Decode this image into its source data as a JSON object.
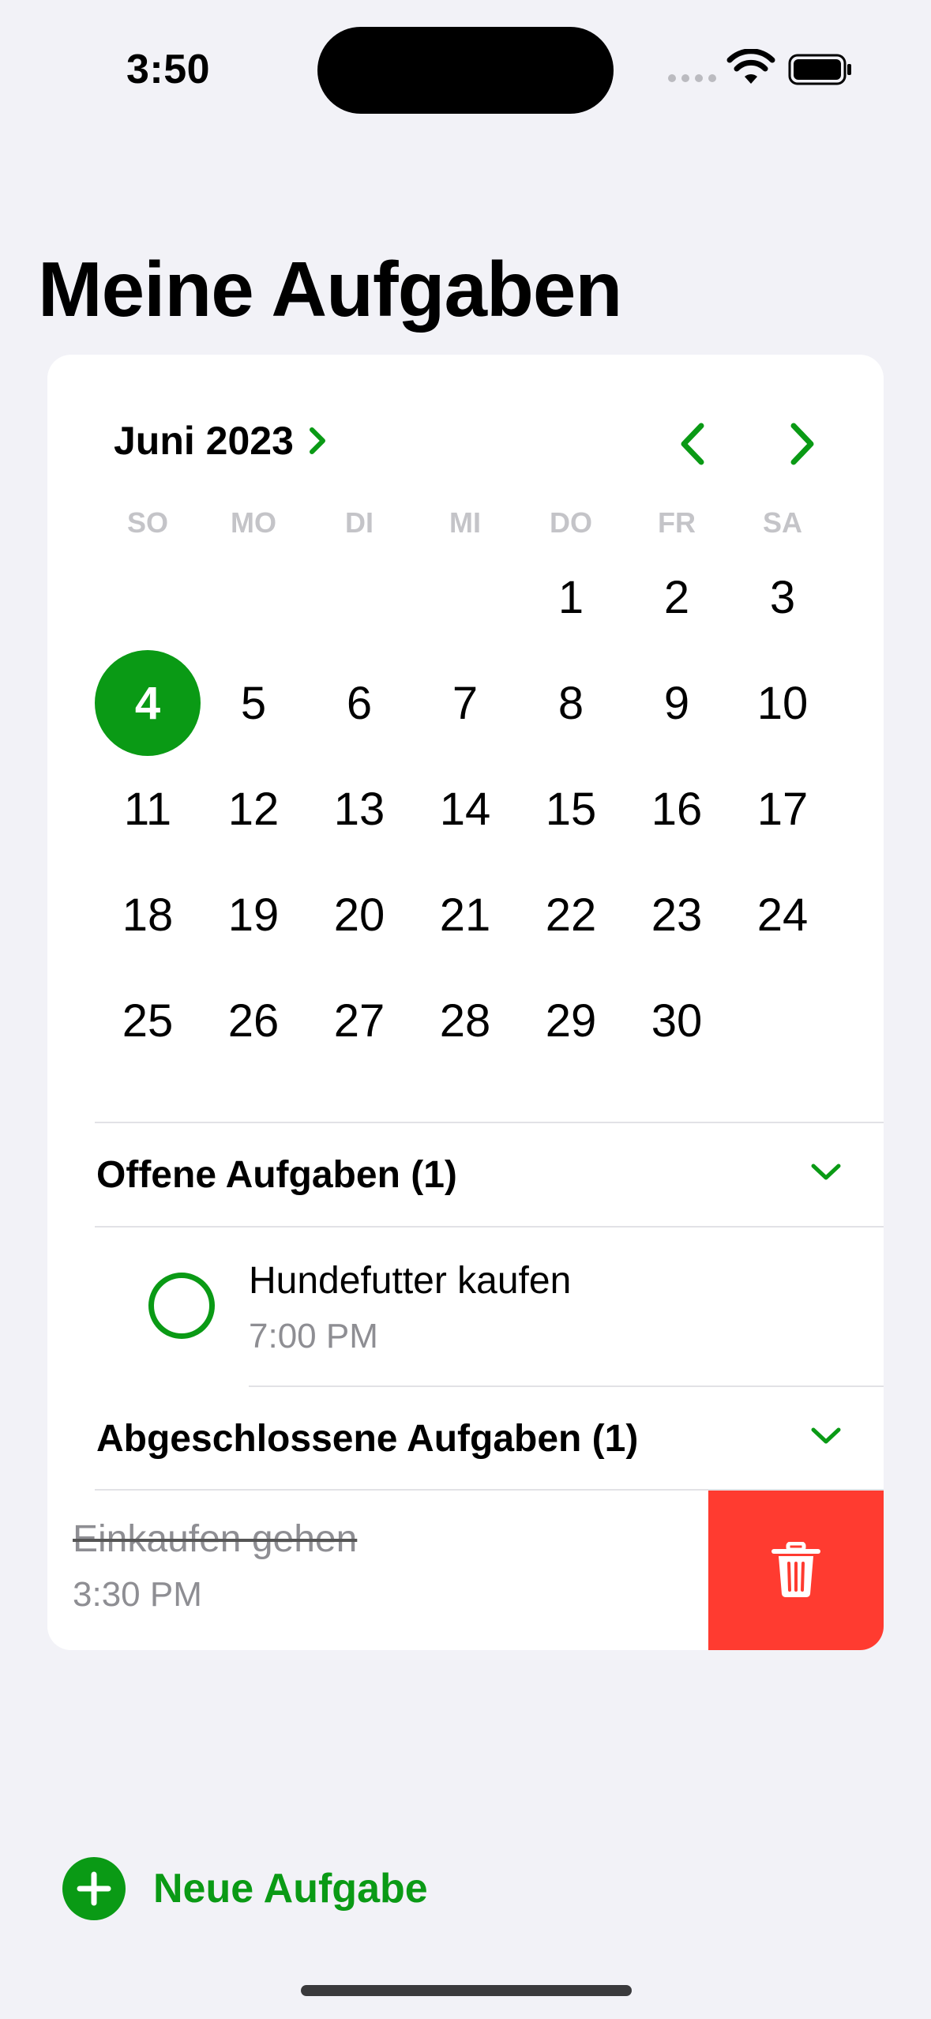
{
  "status_bar": {
    "time": "3:50"
  },
  "page_title": "Meine Aufgaben",
  "calendar": {
    "month_label": "Juni 2023",
    "weekdays": [
      "SO",
      "MO",
      "DI",
      "MI",
      "DO",
      "FR",
      "SA"
    ],
    "selected_day": "4",
    "weeks": [
      [
        "",
        "",
        "",
        "",
        "1",
        "2",
        "3"
      ],
      [
        "4",
        "5",
        "6",
        "7",
        "8",
        "9",
        "10"
      ],
      [
        "11",
        "12",
        "13",
        "14",
        "15",
        "16",
        "17"
      ],
      [
        "18",
        "19",
        "20",
        "21",
        "22",
        "23",
        "24"
      ],
      [
        "25",
        "26",
        "27",
        "28",
        "29",
        "30",
        ""
      ]
    ]
  },
  "open_section": {
    "title": "Offene Aufgaben (1)",
    "tasks": [
      {
        "title": "Hundefutter kaufen",
        "time": "7:00 PM"
      }
    ]
  },
  "done_section": {
    "title": "Abgeschlossene Aufgaben (1)",
    "tasks": [
      {
        "title": "Einkaufen gehen",
        "time": "3:30 PM"
      }
    ]
  },
  "new_task_label": "Neue Aufgabe",
  "colors": {
    "accent": "#0a9a15",
    "delete": "#ff3b30",
    "background": "#f2f2f7"
  }
}
